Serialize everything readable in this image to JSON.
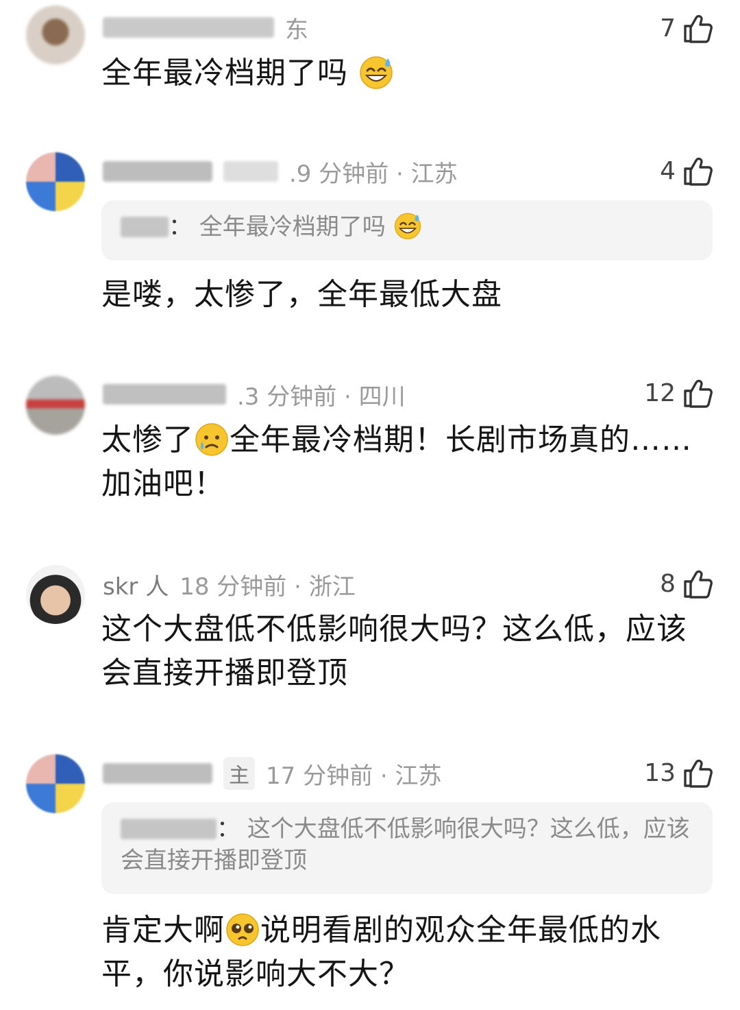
{
  "comments": [
    {
      "meta": {
        "location": "东"
      },
      "likes": "7",
      "text": "全年最冷档期了吗"
    },
    {
      "meta": {
        "time_location": ".9 分钟前 · 江苏"
      },
      "likes": "4",
      "quote": {
        "text": "全年最冷档期了吗"
      },
      "text": "是喽，太惨了，全年最低大盘"
    },
    {
      "meta": {
        "time_location": ".3 分钟前 · 四川"
      },
      "likes": "12",
      "text_a": "太惨了",
      "text_b": "全年最冷档期！长剧市场真的……加油吧！"
    },
    {
      "meta": {
        "name": "skr 人",
        "time_location": "18 分钟前 · 浙江"
      },
      "likes": "8",
      "text": "这个大盘低不低影响很大吗？这么低，应该会直接开播即登顶"
    },
    {
      "meta": {
        "badge": "主",
        "time_location": "17 分钟前 · 江苏"
      },
      "likes": "13",
      "quote": {
        "text": "这个大盘低不低影响很大吗？这么低，应该会直接开播即登顶"
      },
      "text_a": "肯定大啊",
      "text_b": "说明看剧的观众全年最低的水平，你说影响大不大？"
    }
  ],
  "icons": {
    "like": "thumbs-up-icon",
    "emoji_sweat": "grinning-sweat-emoji",
    "emoji_cry": "crying-emoji",
    "emoji_plead": "pleading-emoji"
  },
  "colors": {
    "text": "#151515",
    "meta": "#9a9a9a",
    "quote_bg": "#f4f4f4"
  }
}
